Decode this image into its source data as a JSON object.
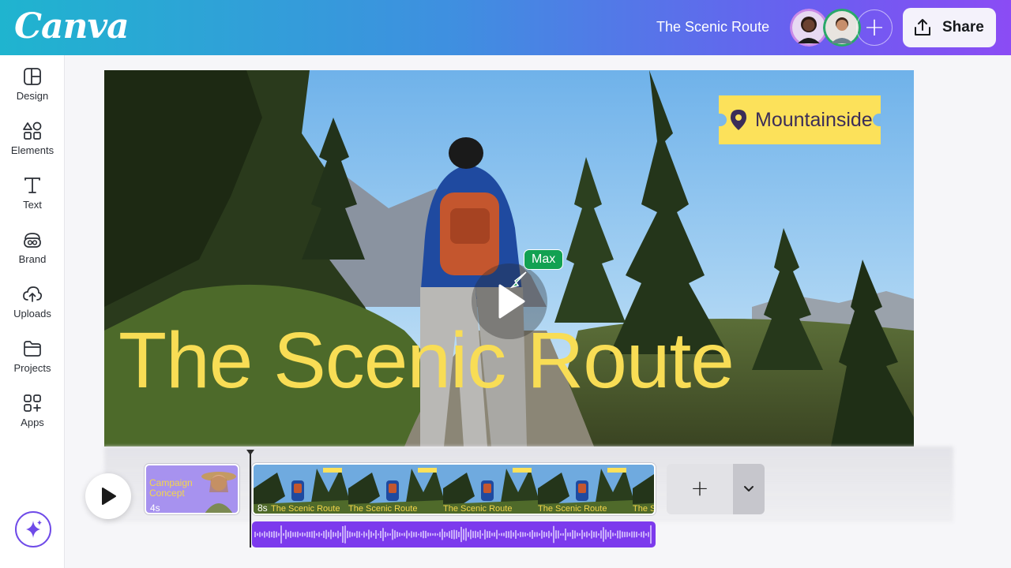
{
  "header": {
    "logo": "Canva",
    "doc_title": "The Scenic Route",
    "share_label": "Share",
    "add_collaborator": "+"
  },
  "sidebar": {
    "items": [
      {
        "label": "Design",
        "icon": "layout-icon"
      },
      {
        "label": "Elements",
        "icon": "shapes-icon"
      },
      {
        "label": "Text",
        "icon": "text-icon"
      },
      {
        "label": "Brand",
        "icon": "brand-icon"
      },
      {
        "label": "Uploads",
        "icon": "cloud-upload-icon"
      },
      {
        "label": "Projects",
        "icon": "folder-icon"
      },
      {
        "label": "Apps",
        "icon": "apps-grid-icon"
      }
    ],
    "magic_icon": "sparkle-icon"
  },
  "canvas": {
    "location_tag": "Mountainside",
    "title_text": "The Scenic Route",
    "cursor_user": "Max"
  },
  "timeline": {
    "clip1": {
      "title": "Campaign Concept",
      "duration": "4s"
    },
    "clip2": {
      "duration": "8s",
      "frame_caption": "The Scenic Route"
    },
    "add_label": "+"
  },
  "colors": {
    "accent": "#7c3aed",
    "title_yellow": "#f8dd55",
    "cursor_green": "#12a152"
  }
}
